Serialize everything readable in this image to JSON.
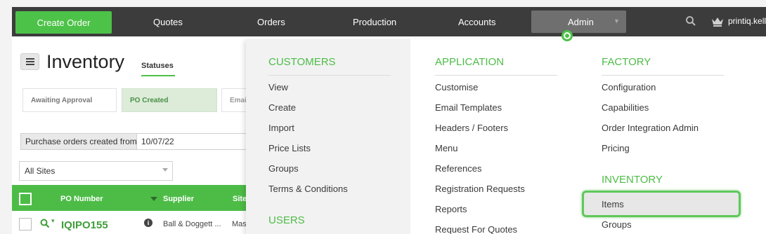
{
  "nav": {
    "create_order": "Create Order",
    "items": [
      "Quotes",
      "Orders",
      "Production",
      "Accounts"
    ],
    "admin": "Admin",
    "user": "printiq.kell",
    "icons": [
      "search-icon",
      "crown-icon"
    ]
  },
  "page": {
    "title": "Inventory",
    "tab": "Statuses",
    "statuses": [
      "Awaiting Approval",
      "PO Created",
      "Emai"
    ],
    "date_filter_label": "Purchase orders created from",
    "date_value": "10/07/22",
    "sites_value": "All Sites"
  },
  "table": {
    "headers": [
      "PO Number",
      "Supplier",
      "Site"
    ],
    "row": {
      "po": "IQIPO155",
      "info": "i",
      "supplier": "Ball & Doggett ...",
      "site": "Mas"
    }
  },
  "menu": {
    "customers": {
      "heading": "CUSTOMERS",
      "items": [
        "View",
        "Create",
        "Import",
        "Price Lists",
        "Groups",
        "Terms & Conditions"
      ]
    },
    "users": {
      "heading": "USERS"
    },
    "application": {
      "heading": "APPLICATION",
      "items": [
        "Customise",
        "Email Templates",
        "Headers / Footers",
        "Menu",
        "References",
        "Registration Requests",
        "Reports",
        "Request For Quotes"
      ]
    },
    "factory": {
      "heading": "FACTORY",
      "items": [
        "Configuration",
        "Capabilities",
        "Order Integration Admin",
        "Pricing"
      ]
    },
    "inventory": {
      "heading": "INVENTORY",
      "items": [
        "Items",
        "Groups"
      ]
    }
  },
  "colors": {
    "accent": "#4dbc47",
    "nav_bg": "#3c3c3c",
    "admin_bg": "#6f6f6f"
  }
}
